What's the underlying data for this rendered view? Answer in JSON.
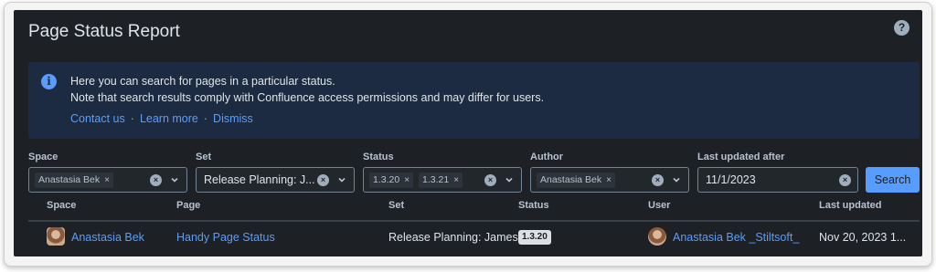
{
  "header": {
    "title": "Page Status Report",
    "help_icon": "help-icon"
  },
  "banner": {
    "line1": "Here you can search for pages in a particular status.",
    "line2": "Note that search results comply with Confluence access permissions and may differ for users.",
    "links": {
      "contact": "Contact us",
      "learn": "Learn more",
      "dismiss": "Dismiss",
      "separator": "·"
    }
  },
  "filters": {
    "space": {
      "label": "Space",
      "chips": [
        "Anastasia Bek"
      ]
    },
    "set": {
      "label": "Set",
      "value": "Release Planning: J..."
    },
    "status": {
      "label": "Status",
      "chips": [
        "1.3.20",
        "1.3.21"
      ]
    },
    "author": {
      "label": "Author",
      "chips": [
        "Anastasia Bek"
      ]
    },
    "last_updated": {
      "label": "Last updated after",
      "value": "11/1/2023"
    },
    "search_label": "Search",
    "chip_remove": "×"
  },
  "table": {
    "headers": [
      "Space",
      "Page",
      "Set",
      "Status",
      "User",
      "Last updated"
    ],
    "rows": [
      {
        "space": "Anastasia Bek",
        "page": "Handy Page Status",
        "set": "Release Planning: James",
        "status": "1.3.20",
        "user": "Anastasia Bek _Stiltsoft_",
        "last_updated": "Nov 20, 2023 1..."
      }
    ]
  },
  "colors": {
    "background": "#1d2125",
    "banner": "#1c2b41",
    "accent": "#579dff",
    "text": "#dee4ea"
  }
}
